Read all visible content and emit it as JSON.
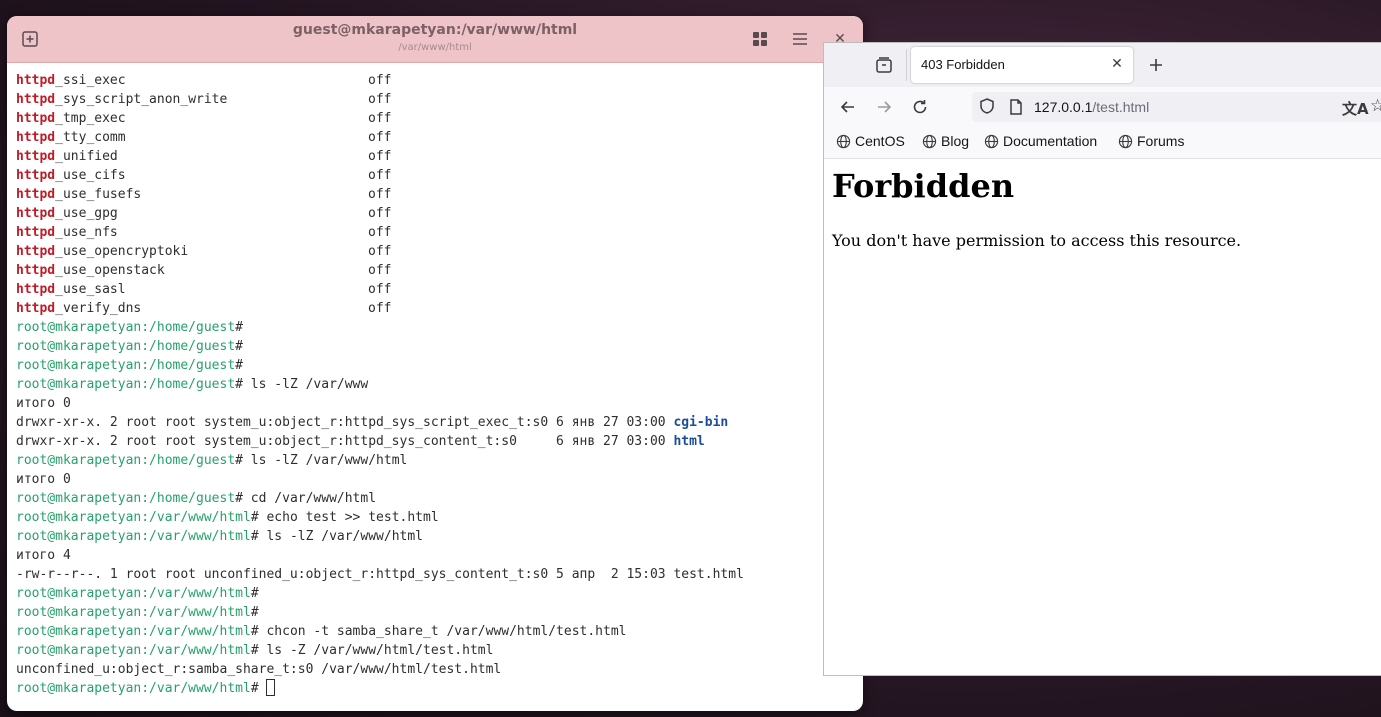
{
  "terminal": {
    "title": "guest@mkarapetyan:/var/www/html",
    "subtitle": "/var/www/html",
    "booleans": [
      {
        "prefix": "httpd",
        "rest": "_ssi_exec",
        "value": "off"
      },
      {
        "prefix": "httpd",
        "rest": "_sys_script_anon_write",
        "value": "off"
      },
      {
        "prefix": "httpd",
        "rest": "_tmp_exec",
        "value": "off"
      },
      {
        "prefix": "httpd",
        "rest": "_tty_comm",
        "value": "off"
      },
      {
        "prefix": "httpd",
        "rest": "_unified",
        "value": "off"
      },
      {
        "prefix": "httpd",
        "rest": "_use_cifs",
        "value": "off"
      },
      {
        "prefix": "httpd",
        "rest": "_use_fusefs",
        "value": "off"
      },
      {
        "prefix": "httpd",
        "rest": "_use_gpg",
        "value": "off"
      },
      {
        "prefix": "httpd",
        "rest": "_use_nfs",
        "value": "off"
      },
      {
        "prefix": "httpd",
        "rest": "_use_opencryptoki",
        "value": "off"
      },
      {
        "prefix": "httpd",
        "rest": "_use_openstack",
        "value": "off"
      },
      {
        "prefix": "httpd",
        "rest": "_use_sasl",
        "value": "off"
      },
      {
        "prefix": "httpd",
        "rest": "_verify_dns",
        "value": "off"
      }
    ],
    "lines": [
      {
        "prompt": "root@mkarapetyan",
        "path": ":/home/guest",
        "cmd": "#"
      },
      {
        "prompt": "root@mkarapetyan",
        "path": ":/home/guest",
        "cmd": "#"
      },
      {
        "prompt": "root@mkarapetyan",
        "path": ":/home/guest",
        "cmd": "#"
      },
      {
        "prompt": "root@mkarapetyan",
        "path": ":/home/guest",
        "cmd": "# ls -lZ /var/www"
      },
      {
        "text": "итого 0"
      },
      {
        "text": "drwxr-xr-x. 2 root root system_u:object_r:httpd_sys_script_exec_t:s0 6 янв 27 03:00 ",
        "dir": "cgi-bin"
      },
      {
        "text": "drwxr-xr-x. 2 root root system_u:object_r:httpd_sys_content_t:s0     6 янв 27 03:00 ",
        "dir": "html"
      },
      {
        "prompt": "root@mkarapetyan",
        "path": ":/home/guest",
        "cmd": "# ls -lZ /var/www/html"
      },
      {
        "text": "итого 0"
      },
      {
        "prompt": "root@mkarapetyan",
        "path": ":/home/guest",
        "cmd": "# cd /var/www/html"
      },
      {
        "prompt": "root@mkarapetyan",
        "path": ":/var/www/html",
        "cmd": "# echo test >> test.html"
      },
      {
        "prompt": "root@mkarapetyan",
        "path": ":/var/www/html",
        "cmd": "# ls -lZ /var/www/html"
      },
      {
        "text": "итого 4"
      },
      {
        "text": "-rw-r--r--. 1 root root unconfined_u:object_r:httpd_sys_content_t:s0 5 апр  2 15:03 test.html"
      },
      {
        "prompt": "root@mkarapetyan",
        "path": ":/var/www/html",
        "cmd": "#"
      },
      {
        "prompt": "root@mkarapetyan",
        "path": ":/var/www/html",
        "cmd": "#"
      },
      {
        "prompt": "root@mkarapetyan",
        "path": ":/var/www/html",
        "cmd": "# chcon -t samba_share_t /var/www/html/test.html"
      },
      {
        "prompt": "root@mkarapetyan",
        "path": ":/var/www/html",
        "cmd": "# ls -Z /var/www/html/test.html"
      },
      {
        "text": "unconfined_u:object_r:samba_share_t:s0 /var/www/html/test.html"
      },
      {
        "prompt": "root@mkarapetyan",
        "path": ":/var/www/html",
        "cmd": "# ",
        "cursor": true
      }
    ]
  },
  "browser": {
    "tab_title": "403 Forbidden",
    "url_host": "127.0.0.1",
    "url_path": "/test.html",
    "bookmarks": [
      "CentOS",
      "Blog",
      "Documentation",
      "Forums"
    ],
    "page_heading": "Forbidden",
    "page_message": "You don't have permission to access this resource."
  }
}
